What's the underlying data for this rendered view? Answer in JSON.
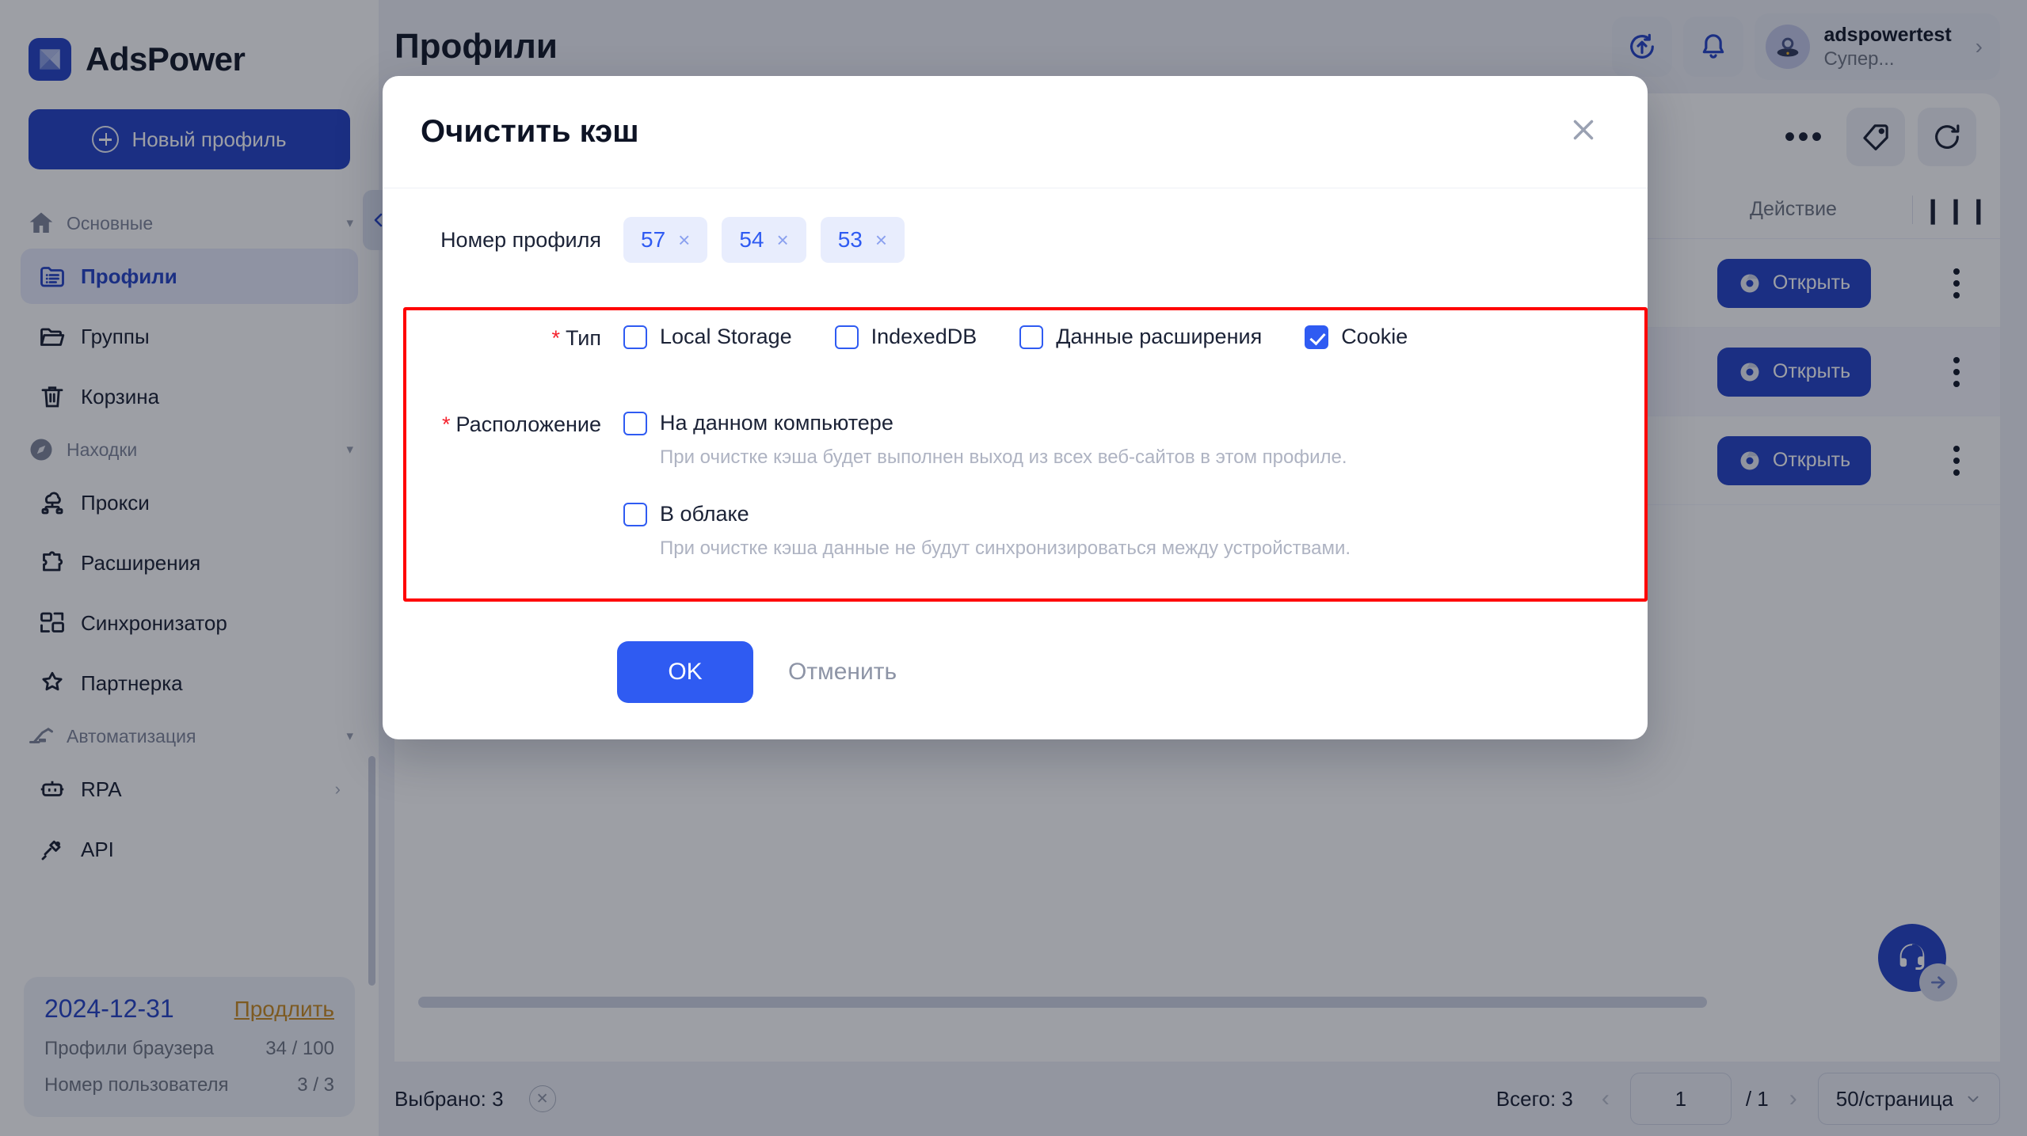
{
  "brand": {
    "name": "AdsPower",
    "logo_icon": "adspower-logo-icon"
  },
  "sidebar": {
    "new_profile_label": "Новый профиль",
    "groups": [
      {
        "label": "Основные",
        "icon": "home-icon",
        "items": [
          {
            "label": "Профили",
            "icon": "folder-list-icon",
            "active": true
          },
          {
            "label": "Группы",
            "icon": "folder-open-icon",
            "active": false
          },
          {
            "label": "Корзина",
            "icon": "trash-icon",
            "active": false
          }
        ]
      },
      {
        "label": "Находки",
        "icon": "compass-icon",
        "items": [
          {
            "label": "Прокси",
            "icon": "proxy-cloud-icon",
            "active": false
          },
          {
            "label": "Расширения",
            "icon": "puzzle-icon",
            "active": false
          },
          {
            "label": "Синхронизатор",
            "icon": "sync-windows-icon",
            "active": false
          },
          {
            "label": "Партнерка",
            "icon": "star-badge-icon",
            "active": false
          }
        ]
      },
      {
        "label": "Автоматизация",
        "icon": "robot-arm-icon",
        "items": [
          {
            "label": "RPA",
            "icon": "robot-icon",
            "active": false,
            "chevron": "›"
          },
          {
            "label": "API",
            "icon": "plug-icon",
            "active": false
          }
        ]
      }
    ],
    "plan": {
      "date": "2024-12-31",
      "renew_label": "Продлить",
      "rows": [
        {
          "label": "Профили браузера",
          "value": "34 / 100"
        },
        {
          "label": "Номер пользователя",
          "value": "3 / 3"
        }
      ]
    },
    "collapse_icon": "chevron-left-icon"
  },
  "header": {
    "title": "Профили",
    "sync_icon": "sync-upload-icon",
    "bell_icon": "bell-icon",
    "user": {
      "name": "adspowertest",
      "role": "Супер...",
      "avatar_icon": "astronaut-avatar-icon",
      "chevron": "›"
    }
  },
  "toolbar": {
    "more_icon": "ellipsis-horizontal-icon",
    "tag_icon": "tag-icon",
    "refresh_icon": "refresh-icon"
  },
  "table": {
    "action_column": "Действие",
    "columns_icon": "columns-settings-icon",
    "rows": [
      {
        "open_label": "Открыть",
        "browser_icon": "chrome-icon",
        "more_icon": "dots-vertical-icon"
      },
      {
        "open_label": "Открыть",
        "browser_icon": "chrome-icon",
        "more_icon": "dots-vertical-icon"
      },
      {
        "open_label": "Открыть",
        "browser_icon": "chrome-icon",
        "more_icon": "dots-vertical-icon"
      }
    ]
  },
  "support": {
    "icon": "headset-icon",
    "arrow_icon": "arrow-right-icon"
  },
  "statusbar": {
    "selected_label": "Выбрано: 3",
    "clear_selection_icon": "close-circle-icon",
    "total_label": "Всего: 3",
    "prev_icon": "‹",
    "next_icon": "›",
    "page_value": "1",
    "page_of": "/ 1",
    "page_size_label": "50/страница",
    "page_size_caret": "chevron-down-icon"
  },
  "modal": {
    "title": "Очистить кэш",
    "close_icon": "close-icon",
    "profile_field": {
      "label": "Номер профиля",
      "tags": [
        {
          "value": "57",
          "remove_icon": "×"
        },
        {
          "value": "54",
          "remove_icon": "×"
        },
        {
          "value": "53",
          "remove_icon": "×"
        }
      ]
    },
    "type_field": {
      "label": "Тип",
      "required": "*",
      "options": [
        {
          "label": "Local Storage",
          "checked": false
        },
        {
          "label": "IndexedDB",
          "checked": false
        },
        {
          "label": "Данные расширения",
          "checked": false
        },
        {
          "label": "Cookie",
          "checked": true
        }
      ]
    },
    "location_field": {
      "label": "Расположение",
      "required": "*",
      "options": [
        {
          "label": "На данном компьютере",
          "checked": false,
          "hint": "При очистке кэша будет выполнен выход из всех веб-сайтов в этом профиле."
        },
        {
          "label": "В облаке",
          "checked": false,
          "hint": "При очистке кэша данные не будут синхронизироваться между устройствами."
        }
      ]
    },
    "ok_label": "OK",
    "cancel_label": "Отменить",
    "highlight_color": "#ff0000"
  },
  "colors": {
    "brand_blue": "#1f3fc4",
    "accent_blue": "#2f5bf2",
    "link_orange": "#c8881d",
    "required_red": "#f5222d",
    "highlight_red": "#ff0000"
  }
}
